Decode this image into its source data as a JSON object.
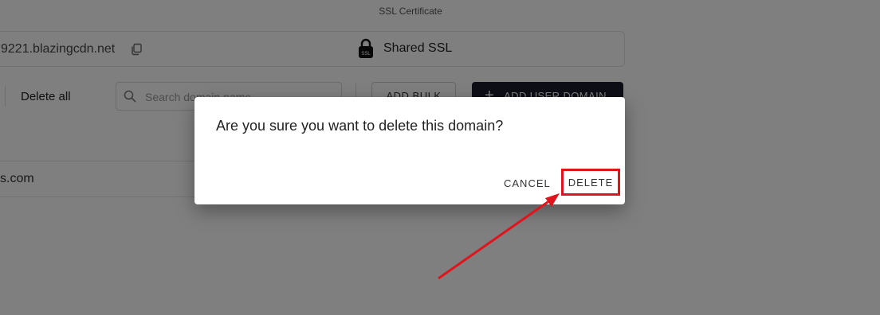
{
  "header": {
    "ssl_caption": "SSL Certificate"
  },
  "info_card": {
    "cname": "9221.blazingcdn.net",
    "ssl_type": "Shared SSL",
    "lock_label": "SSL"
  },
  "toolbar": {
    "delete_all_label": "Delete all",
    "search_placeholder": "Search domain name",
    "add_bulk_label": "ADD BULK",
    "add_user_domain_label": "ADD USER DOMAIN"
  },
  "domains": [
    {
      "name": "s.com"
    }
  ],
  "dialog": {
    "title": "Are you sure you want to delete this domain?",
    "cancel_label": "CANCEL",
    "delete_label": "DELETE"
  },
  "colors": {
    "highlight": "#e0141c",
    "overlay": "rgba(0,0,0,0.5)",
    "primary_button": "#1d1d2f"
  },
  "icons": [
    "copy-icon",
    "lock-icon",
    "search-icon",
    "plus-icon"
  ]
}
